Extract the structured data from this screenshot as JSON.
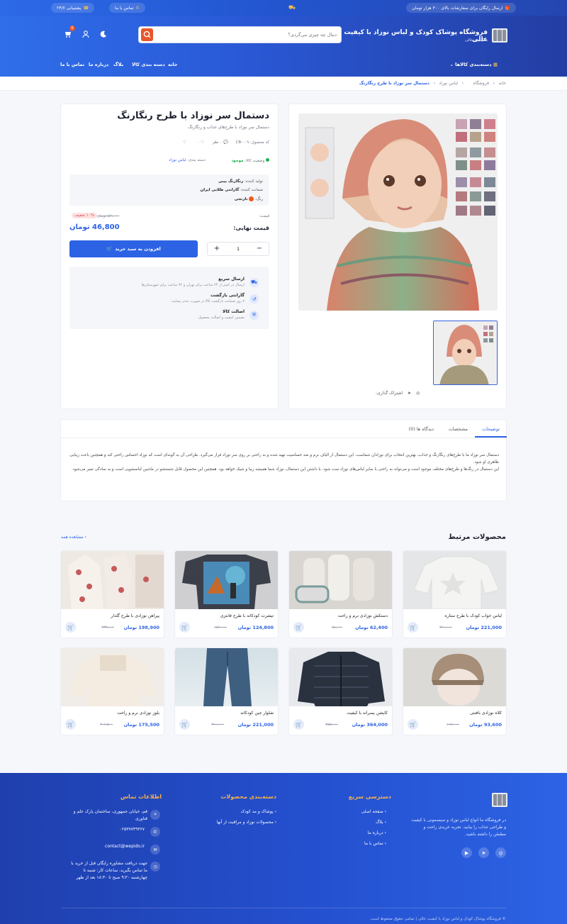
{
  "topbar": {
    "promo": "ارسال رایگان برای سفارشات بالای ۳۰۰ هزار تومان",
    "contact": "تماس با ما",
    "support": "پشتیبانی ۲۴/۷"
  },
  "header": {
    "site_title": "فروشگاه پوشاک کودک و لباس نوزاد با کیفیت عالی",
    "site_subtitle": "با کیفیت عالی",
    "search_placeholder": "دنبال چه چیزی می‌گردی؟",
    "cart_count": "0"
  },
  "nav": {
    "categories": "دسته‌بندی کالاها",
    "items": [
      "خانه",
      "دسته بندی کالا",
      "بلاگ",
      "درباره ما",
      "تماس با ما"
    ]
  },
  "breadcrumb": [
    "خانه",
    "فروشگاه",
    "لباس نوزاد",
    "دستمال سر نوزاد با طرح رنگارنگ"
  ],
  "product": {
    "title": "دستمال سر نوزاد با طرح رنگارنگ",
    "subtitle": "دستمال سر نوزاد با طرح‌های جذاب و رنگارنگ",
    "code": "کد محصول: CB-۰۰۹",
    "comments": "۰ نظر",
    "likes": "۰",
    "status_label": "وضعیت کالا:",
    "status_value": "موجود",
    "category_label": "دسته بندی:",
    "category_value": "لباس نوزاد",
    "producer_label": "تولید کننده:",
    "producer_value": "رنگارنگ بیبی",
    "warranty_label": "ضمانت کننده:",
    "warranty_value": "گارانتی طلایی ایران",
    "color_label": "رنگ:",
    "color_value": "نارنجی",
    "price_label": "قیمت:",
    "old_price": "۵۲,۰۰۰ تومان",
    "discount": "۱۰% تخفیف",
    "final_label": "قیمت نهایی:",
    "final_price": "46,800 تومان",
    "qty": "1",
    "add_to_cart": "افزودن به سبد خرید",
    "share_label": "اشتراک گذاری:"
  },
  "features": [
    {
      "title": "ارسال سریع",
      "desc": "ارسال در کمتر از ۲۴ ساعت برای تهران و ۷۲ ساعت برای شهرستان‌ها"
    },
    {
      "title": "گارانتی بازگشت",
      "desc": "۷ روز ضمانت بازگشت کالا در صورت عدم رضایت"
    },
    {
      "title": "اصالت کالا",
      "desc": "تضمین کیفیت و اصالت محصول"
    }
  ],
  "tabs": [
    "توضیحات",
    "مشخصات",
    "دیدگاه ها (0)"
  ],
  "description": [
    "دستمال سر نوزاد ما با طرح‌های رنگارنگ و جذاب، بهترین انتخاب برای نوزادان شماست. این دستمال از الیاف نرم و ضد حساسیت تهیه شده و به راحتی بر روی سر نوزاد قرار می‌گیرد. طراحی آن به گونه‌ای است که نوزاد احساس راحتی کند و همچنین باعث زیبایی ظاهری او شود.",
    "این دستمال در رنگ‌ها و طرح‌های مختلف موجود است و می‌تواند به راحتی با سایر لباس‌های نوزاد ست شود. با داشتن این دستمال، نوزاد شما همیشه زیبا و شیک خواهد بود. همچنین این محصول قابل شستشو در ماشین لباسشویی است و به سادگی تمیز می‌شود."
  ],
  "related": {
    "title": "محصولات مرتبط",
    "see_all": "مشاهده همه",
    "items": [
      {
        "name": "لباس خواب کودک با طرح ستاره",
        "price": "221,000 تومان",
        "old": "۲۶۰,۰۰۰"
      },
      {
        "name": "دستکش نوزادی نرم و راحت",
        "price": "62,400 تومان",
        "old": "۷۸,۰۰۰"
      },
      {
        "name": "تیشرت کودکانه با طرح فانتزی",
        "price": "124,800 تومان",
        "old": "۱۵۶,۰۰۰"
      },
      {
        "name": "پیراهن نوزادی با طرح گلدار",
        "price": "198,900 تومان",
        "old": "۲۳۴,۰۰۰"
      },
      {
        "name": "کلاه نوزادی بافتنی",
        "price": "93,600 تومان",
        "old": "۱۱۷,۰۰۰"
      },
      {
        "name": "کاپشن پسرانه با کیفیت",
        "price": "364,000 تومان",
        "old": "۴۵۵,۰۰۰"
      },
      {
        "name": "شلوار جین کودکانه",
        "price": "221,000 تومان",
        "old": "۲۶۰,۰۰۰"
      },
      {
        "name": "بلوز نوزادی نرم و راحت",
        "price": "175,500 تومان",
        "old": "۲۰۶,۵۰۰"
      }
    ]
  },
  "footer": {
    "about": "در فروشگاه ما انواع لباس نوزاد و سیسمونی با کیفیت و طراحی جذاب را بیابید. تجربه خریدی راحت و مطمئن را داشته باشید.",
    "quick_title": "دسترسی سریع",
    "quick_links": [
      "صفحه اصلی",
      "بلاگ",
      "درباره ما",
      "تماس با ما"
    ],
    "cat_title": "دسته‌بندی محصولات",
    "cat_links": [
      "پوشاک و مد کودک",
      "محصولات نوزاد و مراقبت از آنها"
    ],
    "contact_title": "اطلاعات تماس",
    "address": "قم، خیابان جمهوری، ساختمان پارک علم و فناوری",
    "phone": "۰۲۵۳۷۷۴۹۳۶۷",
    "email": "contact@wepido.ir",
    "hours": "جهت دریافت مشاوره رایگان قبل از خرید با ما تماس بگیرید. ساعات کار: شنبه تا چهارشنبه ۹:۳۰ صبح تا ۱۸:۳۰ بعد از ظهر",
    "copyright": "© فروشگاه پوشاک کودک و لباس نوزاد با کیفیت عالی | تمامی حقوق محفوظ است."
  },
  "colors": {
    "primary": "#2c63e4",
    "accent": "#e8562b",
    "footer_heading": "#f7b24a",
    "status_green": "#22b14c",
    "swatch_orange": "#f05a1a"
  }
}
